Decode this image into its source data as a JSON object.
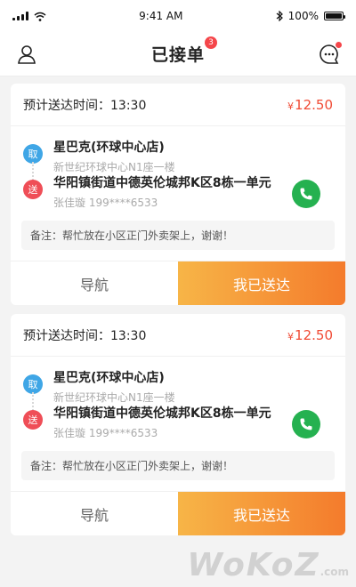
{
  "status_bar": {
    "time": "9:41 AM",
    "battery": "100%"
  },
  "header": {
    "title": "已接单",
    "badge_count": "3"
  },
  "orders": [
    {
      "eta": "预计送达时间：13:30",
      "price_symbol": "¥",
      "price": "12.50",
      "pickup": {
        "tag": "取",
        "name": "星巴克(环球中心店)",
        "address": "新世纪环球中心N1座一楼"
      },
      "dropoff": {
        "tag": "送",
        "name": "华阳镇街道中德英伦城邦K区8栋一单元",
        "contact": "张佳璇 199****6533"
      },
      "note": "备注：帮忙放在小区正门外卖架上，谢谢！",
      "nav_label": "导航",
      "done_label": "我已送达"
    },
    {
      "eta": "预计送达时间：13:30",
      "price_symbol": "¥",
      "price": "12.50",
      "pickup": {
        "tag": "取",
        "name": "星巴克(环球中心店)",
        "address": "新世纪环球中心N1座一楼"
      },
      "dropoff": {
        "tag": "送",
        "name": "华阳镇街道中德英伦城邦K区8栋一单元",
        "contact": "张佳璇 199****6533"
      },
      "note": "备注：帮忙放在小区正门外卖架上，谢谢！",
      "nav_label": "导航",
      "done_label": "我已送达"
    }
  ],
  "watermark": {
    "text": "WoKoZ",
    "suffix": ".com"
  },
  "icons": {
    "status": [
      "signal-icon",
      "wifi-icon",
      "bluetooth-icon",
      "battery-icon"
    ],
    "header": [
      "user-icon",
      "message-icon"
    ],
    "card": [
      "phone-icon"
    ]
  },
  "colors": {
    "price": "#f04b35",
    "pick_tag": "#3fa6e6",
    "drop_tag": "#ef4e57",
    "phone": "#25b150",
    "accent_start": "#f7b547",
    "accent_end": "#f47b2c",
    "badge": "#f5464a"
  }
}
